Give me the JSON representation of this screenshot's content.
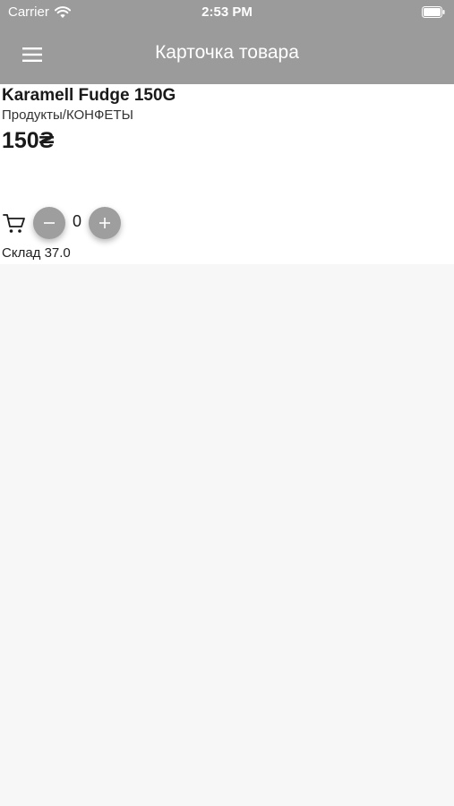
{
  "status_bar": {
    "carrier": "Carrier",
    "time": "2:53 PM",
    "icons": [
      "wifi-icon",
      "battery-icon"
    ]
  },
  "header": {
    "title": "Карточка товара",
    "menu_icon": "hamburger-menu-icon",
    "background_color": "#9b9b9b"
  },
  "product": {
    "name": "Karamell Fudge 150G",
    "category": "Продукты/КОНФЕТЫ",
    "price": "150₴"
  },
  "quantity": {
    "cart_icon": "cart-icon",
    "minus_label": "−",
    "value": "0",
    "plus_label": "+",
    "button_color": "#9e9e9e"
  },
  "stock": {
    "text": "Склад 37.0"
  }
}
